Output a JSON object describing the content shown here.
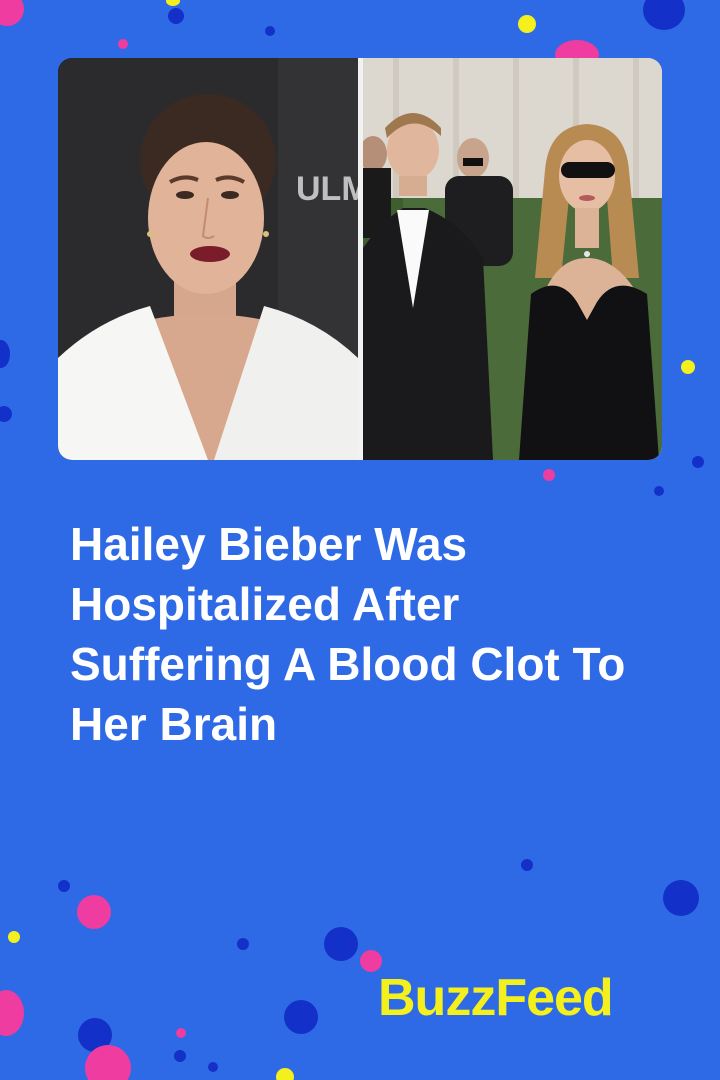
{
  "article": {
    "headline": "Hailey Bieber Was Hospitalized After Suffering A Blood Clot To Her Brain"
  },
  "brand": {
    "name": "BuzzFeed"
  },
  "photos": {
    "left_backdrop_text": "ULM"
  },
  "colors": {
    "background": "#2f6ae6",
    "headline_text": "#ffffff",
    "brand_text": "#f4f01e",
    "dot_pink": "#ee3ca0",
    "dot_navy": "#1330c9",
    "dot_yellow": "#f4f01e"
  }
}
